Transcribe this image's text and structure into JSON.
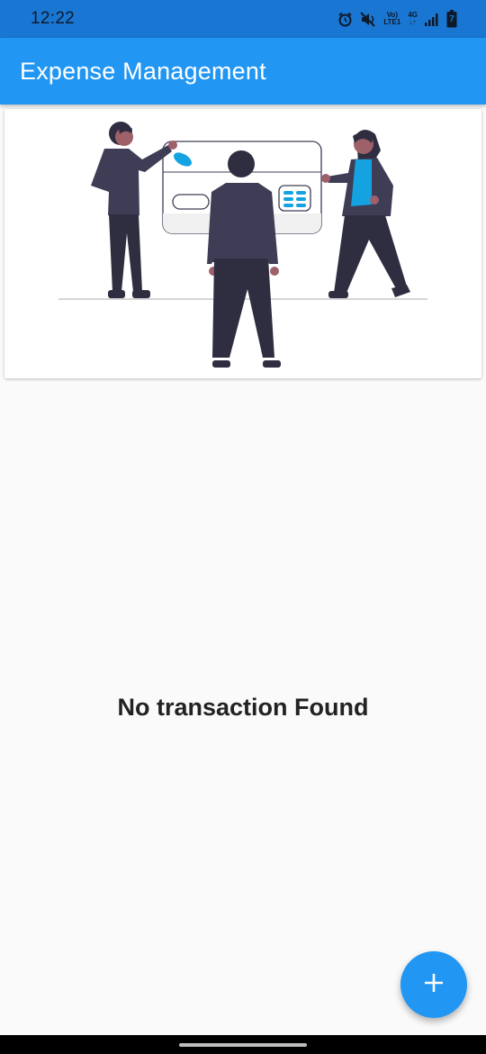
{
  "status_bar": {
    "time": "12:22",
    "network_top": "Vo)",
    "network_bottom": "LTE1",
    "gen": "4G",
    "battery_level": "7",
    "icons": [
      "alarm-icon",
      "mute-icon",
      "volte-icon",
      "4g-icon",
      "signal-icon",
      "battery-icon"
    ]
  },
  "app_bar": {
    "title": "Expense Management",
    "color": "#2196f3"
  },
  "banner": {
    "illustration": "people-with-credit-card-illustration"
  },
  "main": {
    "empty_message": "No transaction Found"
  },
  "fab": {
    "icon": "plus-icon",
    "color": "#2196f3"
  }
}
